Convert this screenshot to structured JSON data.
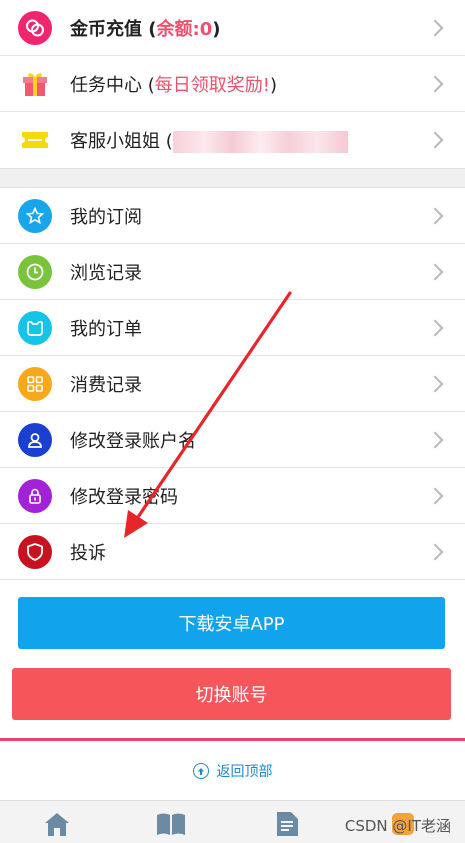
{
  "colors": {
    "accent_red": "#f0506e",
    "download_button": "#11a3ec",
    "switch_button": "#f6565a",
    "link_blue": "#1e88c8",
    "annotation_arrow": "#e8262a"
  },
  "group1": [
    {
      "name": "coin-recharge",
      "icon": "coin-icon",
      "icon_color": "#f0256e",
      "label_prefix": "金币充值 (",
      "label_highlight": "余额:0",
      "label_suffix": ")"
    },
    {
      "name": "task-center",
      "icon": "gift-icon",
      "icon_color": "#f4586f",
      "label_prefix": "任务中心 (",
      "label_highlight": "每日领取奖励!",
      "label_suffix": ")"
    },
    {
      "name": "customer-service",
      "icon": "ticket-icon",
      "icon_color": "#f5d90a",
      "label_prefix": "客服小姐姐 ("
    }
  ],
  "group2": [
    {
      "name": "my-subscription",
      "icon": "star-icon",
      "icon_color": "#19a4ec",
      "label": "我的订阅"
    },
    {
      "name": "browse-history",
      "icon": "clock-icon",
      "icon_color": "#79c43a",
      "label": "浏览记录"
    },
    {
      "name": "my-orders",
      "icon": "bag-icon",
      "icon_color": "#16c4e8",
      "label": "我的订单"
    },
    {
      "name": "consumption-record",
      "icon": "grid-icon",
      "icon_color": "#f7a81b",
      "label": "消费记录"
    },
    {
      "name": "change-username",
      "icon": "user-icon",
      "icon_color": "#1a3fd1",
      "label": "修改登录账户名"
    },
    {
      "name": "change-password",
      "icon": "lock-icon",
      "icon_color": "#a322d8",
      "label": "修改登录密码"
    },
    {
      "name": "complaint",
      "icon": "shield-icon",
      "icon_color": "#c8121f",
      "label": "投诉"
    }
  ],
  "buttons": {
    "download": "下载安卓APP",
    "switch_account": "切换账号"
  },
  "back_to_top": "返回顶部",
  "tabbar": [
    "home-icon",
    "book-icon",
    "document-icon",
    "user-center-icon"
  ],
  "watermark": "CSDN @IT老涵"
}
